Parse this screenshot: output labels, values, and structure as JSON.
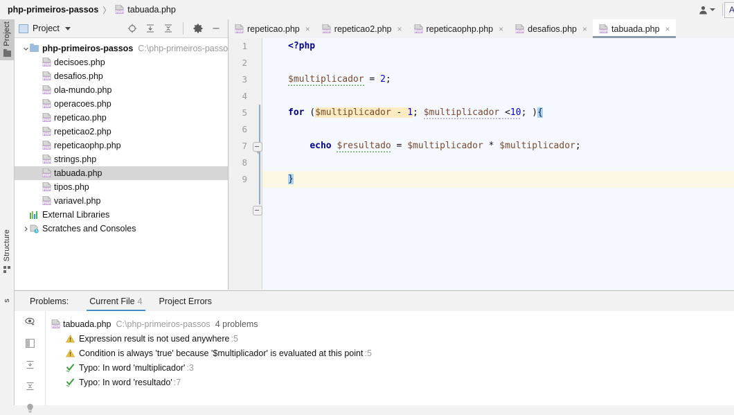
{
  "navbar": {
    "breadcrumb_root": "php-primeiros-passos",
    "breadcrumb_sep": "〉",
    "breadcrumb_file": "tabuada.php",
    "user_icon": "user-icon",
    "add_config_label": "A"
  },
  "left_strip": {
    "project_tab": "Project",
    "structure_tab": "Structure",
    "bottom_tab": "s"
  },
  "project_panel": {
    "title": "Project",
    "tools": [
      "locate-icon",
      "expand-all-icon",
      "collapse-all-icon",
      "settings-icon",
      "minimize-icon"
    ],
    "tree": [
      {
        "label": "php-primeiros-passos",
        "path": "C:\\php-primeiros-passos",
        "kind": "folder",
        "bold": true,
        "indent": 0,
        "arrow": "down",
        "selected": false
      },
      {
        "label": "decisoes.php",
        "path": "",
        "kind": "php",
        "bold": false,
        "indent": 1,
        "arrow": "",
        "selected": false
      },
      {
        "label": "desafios.php",
        "path": "",
        "kind": "php",
        "bold": false,
        "indent": 1,
        "arrow": "",
        "selected": false
      },
      {
        "label": "ola-mundo.php",
        "path": "",
        "kind": "php",
        "bold": false,
        "indent": 1,
        "arrow": "",
        "selected": false
      },
      {
        "label": "operacoes.php",
        "path": "",
        "kind": "php",
        "bold": false,
        "indent": 1,
        "arrow": "",
        "selected": false
      },
      {
        "label": "repeticao.php",
        "path": "",
        "kind": "php",
        "bold": false,
        "indent": 1,
        "arrow": "",
        "selected": false
      },
      {
        "label": "repeticao2.php",
        "path": "",
        "kind": "php",
        "bold": false,
        "indent": 1,
        "arrow": "",
        "selected": false
      },
      {
        "label": "repeticaophp.php",
        "path": "",
        "kind": "php",
        "bold": false,
        "indent": 1,
        "arrow": "",
        "selected": false
      },
      {
        "label": "strings.php",
        "path": "",
        "kind": "php",
        "bold": false,
        "indent": 1,
        "arrow": "",
        "selected": false
      },
      {
        "label": "tabuada.php",
        "path": "",
        "kind": "php",
        "bold": false,
        "indent": 1,
        "arrow": "",
        "selected": true
      },
      {
        "label": "tipos.php",
        "path": "",
        "kind": "php",
        "bold": false,
        "indent": 1,
        "arrow": "",
        "selected": false
      },
      {
        "label": "variavel.php",
        "path": "",
        "kind": "php",
        "bold": false,
        "indent": 1,
        "arrow": "",
        "selected": false
      },
      {
        "label": "External Libraries",
        "path": "",
        "kind": "library",
        "bold": false,
        "indent": 0,
        "arrow": "",
        "selected": false
      },
      {
        "label": "Scratches and Consoles",
        "path": "",
        "kind": "scratch",
        "bold": false,
        "indent": 0,
        "arrow": "right",
        "selected": false
      }
    ]
  },
  "editor": {
    "tabs": [
      {
        "label": "repeticao.php",
        "active": false,
        "close": "×"
      },
      {
        "label": "repeticao2.php",
        "active": false,
        "close": "×"
      },
      {
        "label": "repeticaophp.php",
        "active": false,
        "close": "×"
      },
      {
        "label": "desafios.php",
        "active": false,
        "close": "×"
      },
      {
        "label": "tabuada.php",
        "active": true,
        "close": "×"
      }
    ],
    "line_numbers": [
      "1",
      "2",
      "3",
      "4",
      "5",
      "6",
      "7",
      "8",
      "9"
    ],
    "code_lines": [
      {
        "n": "1",
        "text": "<?php"
      },
      {
        "n": "2",
        "text": ""
      },
      {
        "n": "3",
        "text": "$multiplicador = 2;"
      },
      {
        "n": "4",
        "text": ""
      },
      {
        "n": "5",
        "text": "for ($multiplicador - 1; $multiplicador <10; ){"
      },
      {
        "n": "6",
        "text": ""
      },
      {
        "n": "7",
        "text": "    echo $resultado = $multiplicador * $multiplicador;"
      },
      {
        "n": "8",
        "text": ""
      },
      {
        "n": "9",
        "text": "}"
      }
    ],
    "tokens": {
      "php_open": "<?php",
      "var_multiplicador": "$multiplicador",
      "var_resultado": "$resultado",
      "eq": " = ",
      "two": "2",
      "semi": ";",
      "kw_for": "for",
      "paren_open": " (",
      "minus": " - ",
      "one": "1",
      "semi_sp": "; ",
      "lt": " <",
      "ten": "10",
      "tail": "; )",
      "brace_open": "{",
      "brace_close": "}",
      "kw_echo": "echo",
      "star": " * ",
      "indent": "    ",
      "space": " "
    }
  },
  "problems": {
    "label": "Problems:",
    "tabs": [
      {
        "label": "Current File",
        "count": "4",
        "active": true
      },
      {
        "label": "Project Errors",
        "count": "",
        "active": false
      }
    ],
    "gutter_icons": [
      "eye-icon",
      "split-panel-icon",
      "expand-all-icon",
      "collapse-all-icon",
      "lightbulb-icon"
    ],
    "file_row": {
      "name": "tabuada.php",
      "path": "C:\\php-primeiros-passos",
      "count": "4 problems"
    },
    "items": [
      {
        "icon": "warning-icon",
        "text": "Expression result is not used anywhere",
        "line": ":5"
      },
      {
        "icon": "warning-icon",
        "text": "Condition is always 'true' because '$multiplicador' is evaluated at this point",
        "line": ":5"
      },
      {
        "icon": "spellcheck-icon",
        "text": "Typo: In word 'multiplicador'",
        "line": ":3"
      },
      {
        "icon": "spellcheck-icon",
        "text": "Typo: In word 'resultado'",
        "line": ":7"
      }
    ]
  },
  "colors": {
    "keyword": "#000080",
    "variable": "#79492E",
    "number": "#0000CC",
    "highlight_yellow": "#FAEBC0",
    "highlight_blue": "#A8D3F7",
    "caret_line": "#FDF8E3",
    "editor_bg": "#F5F8FE",
    "accent": "#4A88C7",
    "tab_underline": "#8D9BAF"
  }
}
